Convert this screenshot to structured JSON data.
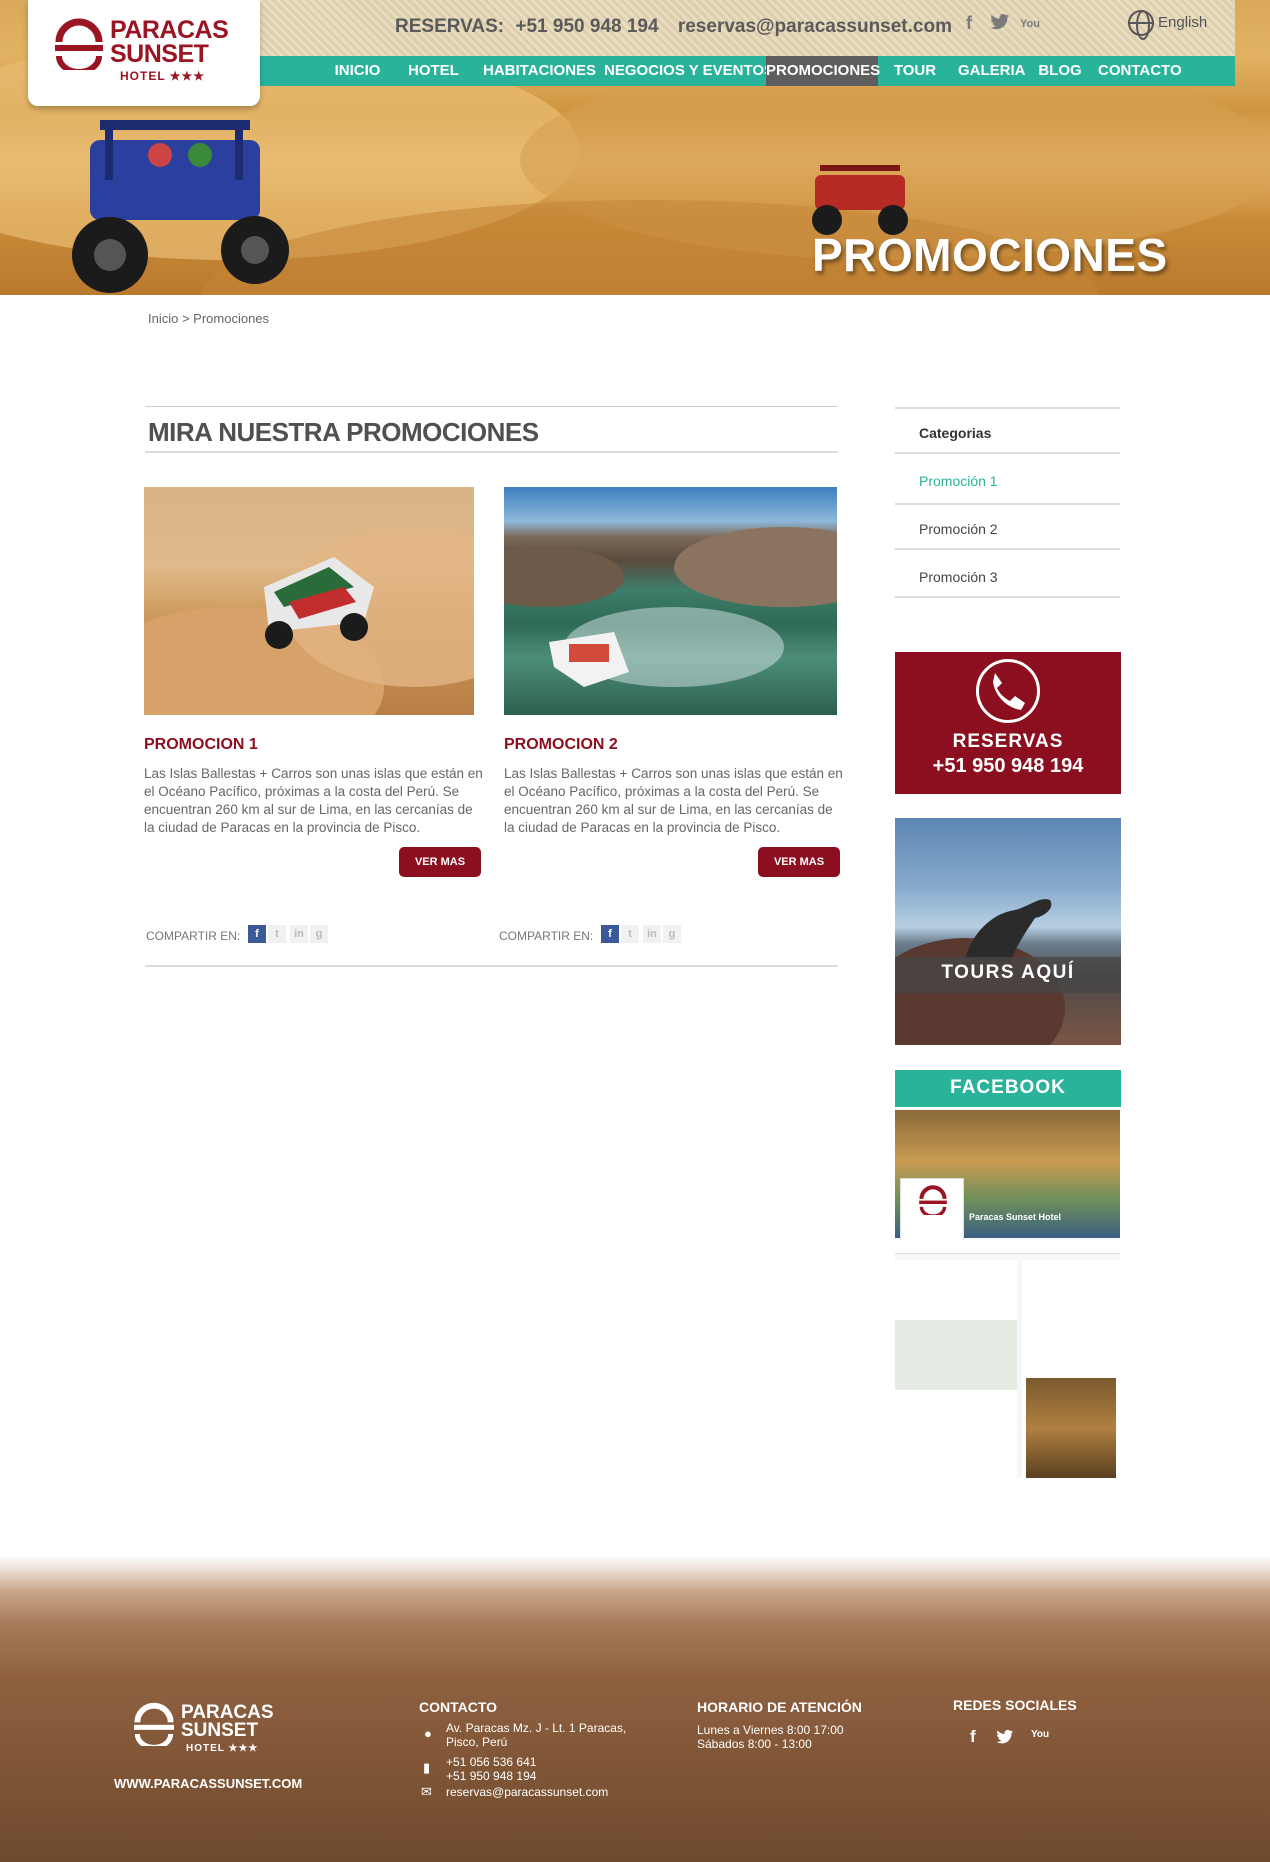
{
  "header": {
    "brand_line1": "PARACAS",
    "brand_line2": "SUNSET",
    "brand_line3": "HOTEL ★★★",
    "reservas_label": "RESERVAS:",
    "reservas_phone": "+51 950 948 194",
    "reservas_email": "reservas@paracassunset.com",
    "social_icons": [
      "facebook-icon",
      "twitter-icon",
      "youtube-icon"
    ],
    "language": "English"
  },
  "nav": {
    "items": [
      {
        "label": "INICIO"
      },
      {
        "label": "HOTEL"
      },
      {
        "label": "HABITACIONES"
      },
      {
        "label": "NEGOCIOS Y EVENTOS"
      },
      {
        "label": "PROMOCIONES"
      },
      {
        "label": "TOUR"
      },
      {
        "label": "GALERIA"
      },
      {
        "label": "BLOG"
      },
      {
        "label": "CONTACTO"
      }
    ],
    "active": "PROMOCIONES"
  },
  "hero": {
    "title": "PROMOCIONES"
  },
  "breadcrumb": "Inicio > Promociones",
  "main": {
    "title": "MIRA NUESTRA PROMOCIONES",
    "promos": [
      {
        "title": "PROMOCION 1",
        "text": "Las Islas Ballestas + Carros son unas islas que están en el Océano Pacífico, próximas a la costa del Perú. Se encuentran 260 km al sur de Lima, en las cercanías de la ciudad de Paracas en la provincia de Pisco.",
        "button": "VER MAS",
        "share_label": "COMPARTIR EN:"
      },
      {
        "title": "PROMOCION 2",
        "text": "Las Islas Ballestas + Carros son unas islas que están en el Océano Pacífico, próximas a la costa del Perú. Se encuentran 260 km al sur de Lima, en las cercanías de la ciudad de Paracas en la provincia de Pisco.",
        "button": "VER MAS",
        "share_label": "COMPARTIR EN:"
      }
    ]
  },
  "sidebar": {
    "categories_title": "Categorias",
    "categories": [
      {
        "label": "Promoción 1",
        "active": true
      },
      {
        "label": "Promoción 2",
        "active": false
      },
      {
        "label": "Promoción 3",
        "active": false
      }
    ],
    "reservas_title": "RESERVAS",
    "reservas_phone": "+51 950 948 194",
    "tours_label": "TOURS AQUÍ",
    "facebook_title": "FACEBOOK",
    "facebook_page_name": "Paracas Sunset Hotel"
  },
  "footer": {
    "url": "WWW.PARACASSUNSET.COM",
    "contacto_title": "CONTACTO",
    "address_line1": "Av. Paracas Mz. J - Lt. 1 Paracas,",
    "address_line2": "Pisco, Perú",
    "phone1": "+51 056 536 641",
    "phone2": "+51 950 948 194",
    "email": "reservas@paracassunset.com",
    "horario_title": "HORARIO DE ATENCIÓN",
    "horario_line1": "Lunes a Viernes 8:00 17:00",
    "horario_line2": "Sábados 8:00 - 13:00",
    "redes_title": "REDES SOCIALES"
  },
  "colors": {
    "brand_red": "#8b0f1f",
    "teal": "#2ab39b",
    "nav_active": "#5e5e5e"
  }
}
